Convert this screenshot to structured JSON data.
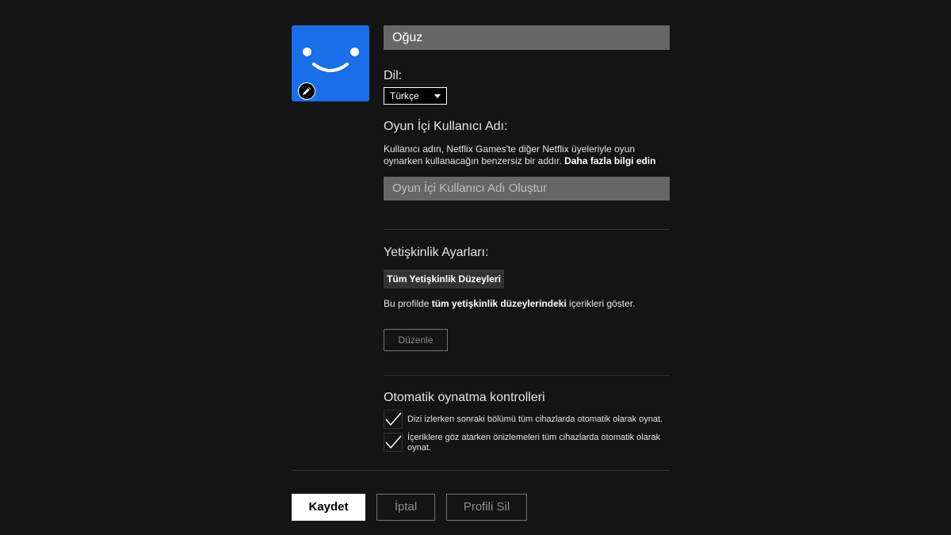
{
  "profile": {
    "name": "Oğuz",
    "avatar_icon": "smiley-face-avatar",
    "edit_icon": "pencil-icon",
    "avatar_color": "#1a6ee8"
  },
  "language": {
    "label": "Dil:",
    "selected": "Türkçe"
  },
  "gamer_handle": {
    "title": "Oyun İçi Kullanıcı Adı:",
    "description": "Kullanıcı adın, Netflix Games'te diğer Netflix üyeleriyle oyun oynarken kullanacağın benzersiz bir addır.",
    "learn_more": "Daha fazla bilgi edin",
    "placeholder": "Oyun İçi Kullanıcı Adı Oluştur"
  },
  "maturity": {
    "title": "Yetişkinlik Ayarları:",
    "level_button": "Tüm Yetişkinlik Düzeyleri",
    "desc_prefix": "Bu profilde",
    "desc_bold": "tüm yetişkinlik düzeylerindeki",
    "desc_suffix": "içerikleri göster.",
    "edit_button": "Düzenle"
  },
  "autoplay": {
    "title": "Otomatik oynatma kontrolleri",
    "options": [
      {
        "label": "Dizi izlerken sonraki bölümü tüm cihazlarda otomatik olarak oynat.",
        "checked": true
      },
      {
        "label": "İçeriklere göz atarken önizlemeleri tüm cihazlarda otomatik olarak oynat.",
        "checked": true
      }
    ]
  },
  "actions": {
    "save": "Kaydet",
    "cancel": "İptal",
    "delete": "Profili Sil"
  }
}
